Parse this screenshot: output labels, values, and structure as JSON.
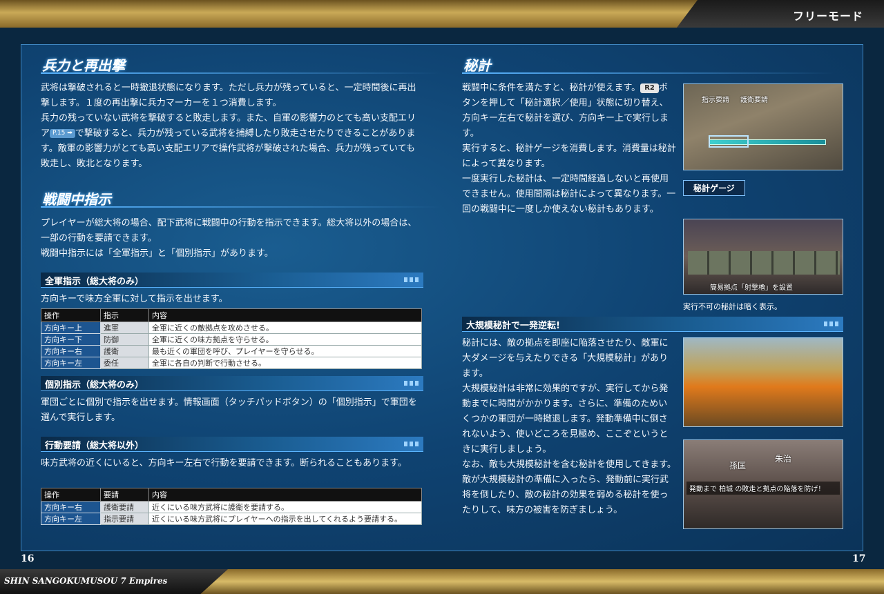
{
  "header": {
    "mode_title": "フリーモード"
  },
  "footer": {
    "game_title": "SHIN SANGOKUMUSOU 7 Empires",
    "page_left": "16",
    "page_right": "17"
  },
  "left": {
    "troops": {
      "title": "兵力と再出撃",
      "p1": "武将は撃破されると一時撤退状態になります。ただし兵力が残っていると、一定時間後に再出撃します。１度の再出撃に兵力マーカーを１つ消費します。",
      "p2a": "兵力の残っていない武将を撃破すると敗走します。また、自軍の影響力のとても高い支配エリア",
      "p2_ref": "P.15 ➡",
      "p2b": "で撃破すると、兵力が残っている武将を捕縛したり敗走させたりできることがあります。敵軍の影響力がとても高い支配エリアで操作武将が撃破された場合、兵力が残っていても敗走し、敗北となります。"
    },
    "battle": {
      "title": "戦闘中指示",
      "p1": "プレイヤーが総大将の場合、配下武将に戦闘中の行動を指示できます。総大将以外の場合は、一部の行動を要請できます。",
      "p2": "戦闘中指示には「全軍指示」と「個別指示」があります。"
    },
    "all_army": {
      "heading": "全軍指示（総大将のみ）",
      "text": "方向キーで味方全軍に対して指示を出せます。",
      "headers": [
        "操作",
        "指示",
        "内容"
      ],
      "rows": [
        [
          "方向キー上",
          "進軍",
          "全軍に近くの敵拠点を攻めさせる。"
        ],
        [
          "方向キー下",
          "防御",
          "全軍に近くの味方拠点を守らせる。"
        ],
        [
          "方向キー右",
          "護衛",
          "最も近くの軍団を呼び、プレイヤーを守らせる。"
        ],
        [
          "方向キー左",
          "委任",
          "全軍に各自の判断で行動させる。"
        ]
      ]
    },
    "individual": {
      "heading": "個別指示（総大将のみ）",
      "text": "軍団ごとに個別で指示を出せます。情報画面（タッチパッドボタン）の「個別指示」で軍団を選んで実行します。"
    },
    "request": {
      "heading": "行動要請（総大将以外）",
      "text": "味方武将の近くにいると、方向キー左右で行動を要請できます。断られることもあります。",
      "headers": [
        "操作",
        "要請",
        "内容"
      ],
      "rows": [
        [
          "方向キー右",
          "護衛要請",
          "近くにいる味方武将に護衛を要請する。"
        ],
        [
          "方向キー左",
          "指示要請",
          "近くにいる味方武将にプレイヤーへの指示を出してくれるよう要請する。"
        ]
      ]
    }
  },
  "right": {
    "secret": {
      "title": "秘計",
      "p1a": "戦闘中に条件を満たすと、秘計が使えます。",
      "r2": "R2",
      "p1b": "ボタンを押して「秘計選択／使用」状態に切り替え、方向キー左右で秘計を選び、方向キー上で実行します。",
      "p2": "実行すると、秘計ゲージを消費します。消費量は秘計によって異なります。",
      "p3": "一度実行した秘計は、一定時間経過しないと再使用できません。使用間隔は秘計によって異なります。一回の戦闘中に一度しか使えない秘計もあります。",
      "gauge_label": "秘計ゲージ",
      "shot1_text_a": "指示要請",
      "shot1_text_b": "護衛要請",
      "shot2_text": "簡易拠点「射撃櫓」を設置",
      "shot2_caption": "実行不可の秘計は暗く表示。"
    },
    "large": {
      "heading": "大規模秘計で一発逆転!",
      "p1": "秘計には、敵の拠点を即座に陥落させたり、敵軍に大ダメージを与えたりできる「大規模秘計」があります。",
      "p2": "大規模秘計は非常に効果的ですが、実行してから発動までに時間がかかります。さらに、準備のためいくつかの軍団が一時撤退します。発動準備中に倒されないよう、使いどころを見極め、ここぞというときに実行しましょう。",
      "p3": "なお、敵も大規模秘計を含む秘計を使用してきます。敵が大規模秘計の準備に入ったら、発動前に実行武将を倒したり、敵の秘計の効果を弱める秘計を使ったりして、味方の被害を防ぎましょう。",
      "shot4_name_a": "孫匡",
      "shot4_name_b": "朱治",
      "shot4_banner": "発動まで 柏城 の敗走と拠点の陥落を防げ！"
    }
  }
}
